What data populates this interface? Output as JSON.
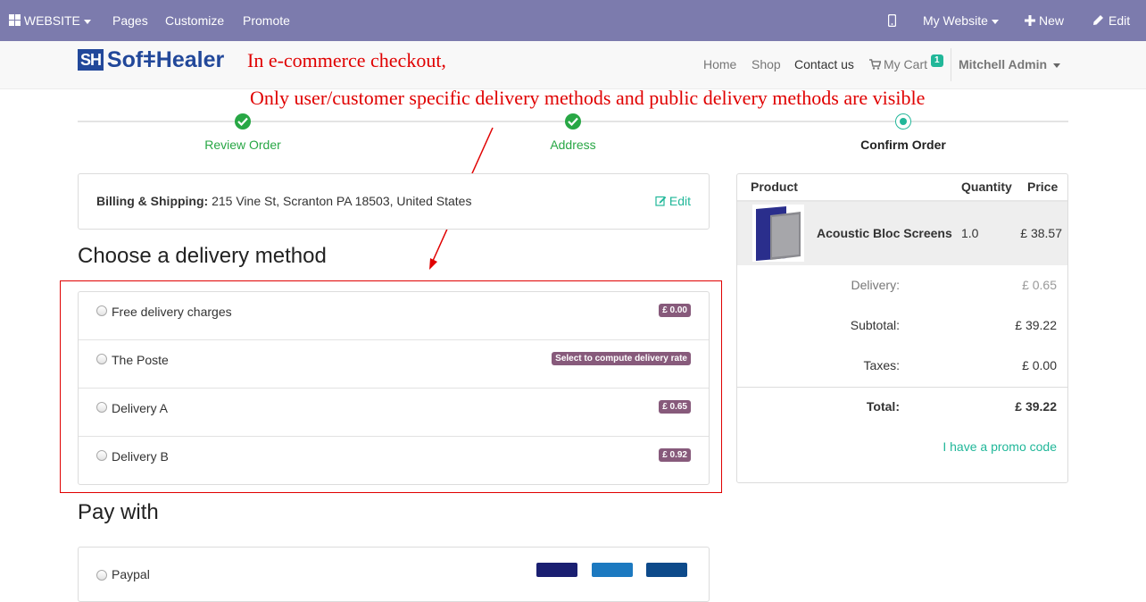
{
  "topbar": {
    "website_label": "WEBSITE",
    "menu": [
      "Pages",
      "Customize",
      "Promote"
    ],
    "my_website_label": "My Website",
    "new_label": "New",
    "edit_label": "Edit"
  },
  "brand": {
    "logo_text": "SofǂHealer",
    "logo_mark": "SH"
  },
  "navbar": {
    "links": [
      "Home",
      "Shop",
      "Contact us"
    ],
    "cart_label": "My Cart",
    "cart_count": "1",
    "user_name": "Mitchell Admin"
  },
  "annotation": {
    "line1": "In e-commerce checkout,",
    "line2": "Only user/customer specific delivery methods and public delivery methods are visible"
  },
  "wizard": {
    "steps": [
      {
        "label": "Review Order",
        "state": "done"
      },
      {
        "label": "Address",
        "state": "done"
      },
      {
        "label": "Confirm Order",
        "state": "current"
      }
    ]
  },
  "billing": {
    "label": "Billing & Shipping:",
    "address": "215 Vine St, Scranton PA 18503, United States",
    "edit_label": "Edit"
  },
  "delivery": {
    "heading": "Choose a delivery method",
    "methods": [
      {
        "name": "Free delivery charges",
        "badge": "£ 0.00"
      },
      {
        "name": "The Poste",
        "badge": "Select to compute delivery rate"
      },
      {
        "name": "Delivery A",
        "badge": "£ 0.65"
      },
      {
        "name": "Delivery B",
        "badge": "£ 0.92"
      }
    ]
  },
  "payment": {
    "heading": "Pay with",
    "first_option": "Paypal"
  },
  "summary": {
    "headers": {
      "product": "Product",
      "quantity": "Quantity",
      "price": "Price"
    },
    "line": {
      "name": "Acoustic Bloc Screens",
      "quantity": "1.0",
      "price": "£ 38.57"
    },
    "delivery_label": "Delivery:",
    "delivery_value": "£ 0.65",
    "subtotal_label": "Subtotal:",
    "subtotal_value": "£ 39.22",
    "taxes_label": "Taxes:",
    "taxes_value": "£ 0.00",
    "total_label": "Total:",
    "total_value": "£ 39.22",
    "promo_label": "I have a promo code"
  },
  "colors": {
    "topbar": "#7c7bad",
    "accent_teal": "#21b799",
    "success_green": "#28a745",
    "badge_purple": "#875a7b",
    "annotation_red": "#e00000"
  }
}
